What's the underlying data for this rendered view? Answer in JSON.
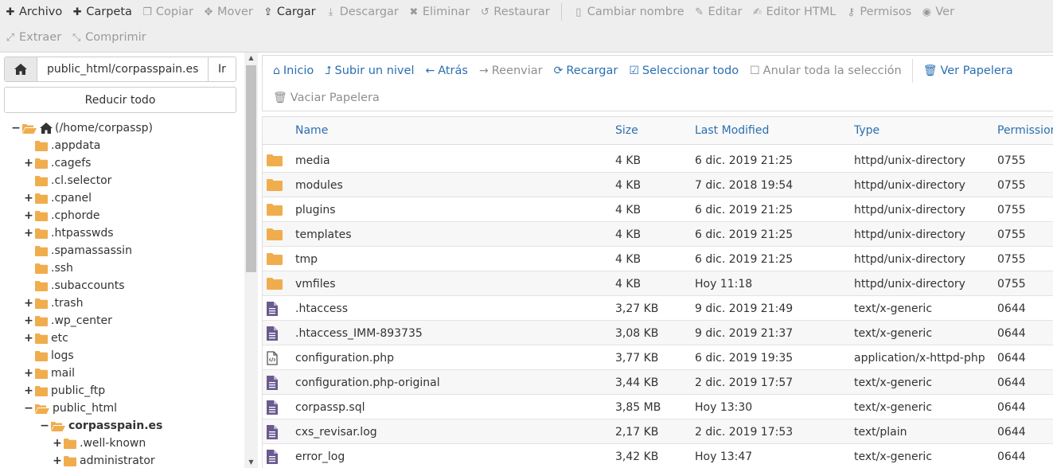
{
  "toolbar": {
    "row1": [
      {
        "label": "Archivo",
        "icon": "plus-icon",
        "glyph": "✚",
        "disabled": false
      },
      {
        "label": "Carpeta",
        "icon": "plus-icon",
        "glyph": "✚",
        "disabled": false
      },
      {
        "label": "Copiar",
        "icon": "copy-icon",
        "glyph": "❐",
        "disabled": true
      },
      {
        "label": "Mover",
        "icon": "move-icon",
        "glyph": "✥",
        "disabled": true
      },
      {
        "label": "Cargar",
        "icon": "upload-icon",
        "glyph": "⇪",
        "disabled": false
      },
      {
        "label": "Descargar",
        "icon": "download-icon",
        "glyph": "⤓",
        "disabled": true
      },
      {
        "label": "Eliminar",
        "icon": "delete-icon",
        "glyph": "✖",
        "disabled": true
      },
      {
        "label": "Restaurar",
        "icon": "restore-icon",
        "glyph": "↺",
        "disabled": true
      },
      {
        "label": "Cambiar nombre",
        "icon": "file-icon",
        "glyph": "▯",
        "disabled": true
      },
      {
        "label": "Editar",
        "icon": "pencil-icon",
        "glyph": "✎",
        "disabled": true
      },
      {
        "label": "Editor HTML",
        "icon": "edit-icon",
        "glyph": "✍",
        "disabled": true
      },
      {
        "label": "Permisos",
        "icon": "key-icon",
        "glyph": "⚷",
        "disabled": true
      },
      {
        "label": "Ver",
        "icon": "eye-icon",
        "glyph": "◉",
        "disabled": true
      }
    ],
    "row2": [
      {
        "label": "Extraer",
        "icon": "expand-icon",
        "glyph": "⤢",
        "disabled": true
      },
      {
        "label": "Comprimir",
        "icon": "compress-icon",
        "glyph": "⤡",
        "disabled": true
      }
    ]
  },
  "left": {
    "path_value": "public_html/corpasspain.es",
    "go_label": "Ir",
    "collapse_label": "Reducir todo",
    "tree": [
      {
        "label": "(/home/corpassp)",
        "toggle": "−",
        "depth": 0,
        "open": true,
        "home": true,
        "bold": false
      },
      {
        "label": ".appdata",
        "toggle": "",
        "depth": 1,
        "open": false,
        "home": false,
        "bold": false
      },
      {
        "label": ".cagefs",
        "toggle": "+",
        "depth": 1,
        "open": false,
        "home": false,
        "bold": false
      },
      {
        "label": ".cl.selector",
        "toggle": "",
        "depth": 1,
        "open": false,
        "home": false,
        "bold": false
      },
      {
        "label": ".cpanel",
        "toggle": "+",
        "depth": 1,
        "open": false,
        "home": false,
        "bold": false
      },
      {
        "label": ".cphorde",
        "toggle": "+",
        "depth": 1,
        "open": false,
        "home": false,
        "bold": false
      },
      {
        "label": ".htpasswds",
        "toggle": "+",
        "depth": 1,
        "open": false,
        "home": false,
        "bold": false
      },
      {
        "label": ".spamassassin",
        "toggle": "",
        "depth": 1,
        "open": false,
        "home": false,
        "bold": false
      },
      {
        "label": ".ssh",
        "toggle": "",
        "depth": 1,
        "open": false,
        "home": false,
        "bold": false
      },
      {
        "label": ".subaccounts",
        "toggle": "",
        "depth": 1,
        "open": false,
        "home": false,
        "bold": false
      },
      {
        "label": ".trash",
        "toggle": "+",
        "depth": 1,
        "open": false,
        "home": false,
        "bold": false
      },
      {
        "label": ".wp_center",
        "toggle": "+",
        "depth": 1,
        "open": false,
        "home": false,
        "bold": false
      },
      {
        "label": "etc",
        "toggle": "+",
        "depth": 1,
        "open": false,
        "home": false,
        "bold": false
      },
      {
        "label": "logs",
        "toggle": "",
        "depth": 1,
        "open": false,
        "home": false,
        "bold": false
      },
      {
        "label": "mail",
        "toggle": "+",
        "depth": 1,
        "open": false,
        "home": false,
        "bold": false
      },
      {
        "label": "public_ftp",
        "toggle": "+",
        "depth": 1,
        "open": false,
        "home": false,
        "bold": false
      },
      {
        "label": "public_html",
        "toggle": "−",
        "depth": 1,
        "open": true,
        "home": false,
        "bold": false
      },
      {
        "label": "corpasspain.es",
        "toggle": "−",
        "depth": 2,
        "open": true,
        "home": false,
        "bold": true
      },
      {
        "label": ".well-known",
        "toggle": "+",
        "depth": 3,
        "open": false,
        "home": false,
        "bold": false
      },
      {
        "label": "administrator",
        "toggle": "+",
        "depth": 3,
        "open": false,
        "home": false,
        "bold": false
      }
    ]
  },
  "nav": {
    "row1": [
      {
        "label": "Inicio",
        "icon": "home-icon",
        "glyph": "⌂",
        "disabled": false
      },
      {
        "label": "Subir un nivel",
        "icon": "level-up-icon",
        "glyph": "⮥",
        "disabled": false
      },
      {
        "label": "Atrás",
        "icon": "arrow-left-icon",
        "glyph": "←",
        "disabled": false
      },
      {
        "label": "Reenviar",
        "icon": "arrow-right-icon",
        "glyph": "→",
        "disabled": true
      },
      {
        "label": "Recargar",
        "icon": "refresh-icon",
        "glyph": "⟳",
        "disabled": false
      },
      {
        "label": "Seleccionar todo",
        "icon": "check-square-icon",
        "glyph": "☑",
        "disabled": false
      },
      {
        "label": "Anular toda la selección",
        "icon": "square-icon",
        "glyph": "☐",
        "disabled": true
      },
      {
        "label": "Ver Papelera",
        "icon": "trash-icon",
        "glyph": "🗑",
        "disabled": false
      }
    ],
    "row2": [
      {
        "label": "Vaciar Papelera",
        "icon": "trash-icon",
        "glyph": "🗑",
        "disabled": true
      }
    ]
  },
  "table": {
    "columns": [
      "Name",
      "Size",
      "Last Modified",
      "Type",
      "Permissions"
    ],
    "rows": [
      {
        "icon": "folder-icon",
        "name": "media",
        "size": "4 KB",
        "modified": "6 dic. 2019 21:25",
        "type": "httpd/unix-directory",
        "perms": "0755"
      },
      {
        "icon": "folder-icon",
        "name": "modules",
        "size": "4 KB",
        "modified": "7 dic. 2018 19:54",
        "type": "httpd/unix-directory",
        "perms": "0755"
      },
      {
        "icon": "folder-icon",
        "name": "plugins",
        "size": "4 KB",
        "modified": "6 dic. 2019 21:25",
        "type": "httpd/unix-directory",
        "perms": "0755"
      },
      {
        "icon": "folder-icon",
        "name": "templates",
        "size": "4 KB",
        "modified": "6 dic. 2019 21:25",
        "type": "httpd/unix-directory",
        "perms": "0755"
      },
      {
        "icon": "folder-icon",
        "name": "tmp",
        "size": "4 KB",
        "modified": "6 dic. 2019 21:25",
        "type": "httpd/unix-directory",
        "perms": "0755"
      },
      {
        "icon": "folder-icon",
        "name": "vmfiles",
        "size": "4 KB",
        "modified": "Hoy 11:18",
        "type": "httpd/unix-directory",
        "perms": "0755"
      },
      {
        "icon": "file-text-icon",
        "name": ".htaccess",
        "size": "3,27 KB",
        "modified": "9 dic. 2019 21:49",
        "type": "text/x-generic",
        "perms": "0644"
      },
      {
        "icon": "file-text-icon",
        "name": ".htaccess_IMM-893735",
        "size": "3,08 KB",
        "modified": "9 dic. 2019 21:37",
        "type": "text/x-generic",
        "perms": "0644"
      },
      {
        "icon": "file-code-icon",
        "name": "configuration.php",
        "size": "3,77 KB",
        "modified": "6 dic. 2019 19:35",
        "type": "application/x-httpd-php",
        "perms": "0644"
      },
      {
        "icon": "file-text-icon",
        "name": "configuration.php-original",
        "size": "3,44 KB",
        "modified": "2 dic. 2019 17:57",
        "type": "text/x-generic",
        "perms": "0644"
      },
      {
        "icon": "file-text-icon",
        "name": "corpassp.sql",
        "size": "3,85 MB",
        "modified": "Hoy 13:30",
        "type": "text/x-generic",
        "perms": "0644"
      },
      {
        "icon": "file-text-icon",
        "name": "cxs_revisar.log",
        "size": "2,17 KB",
        "modified": "2 dic. 2019 17:53",
        "type": "text/plain",
        "perms": "0644"
      },
      {
        "icon": "file-text-icon",
        "name": "error_log",
        "size": "3,42 KB",
        "modified": "Hoy 13:47",
        "type": "text/x-generic",
        "perms": "0644"
      }
    ]
  },
  "colors": {
    "folder": "#f0ad4e",
    "file": "#6a5a8f",
    "link": "#2a6fb1",
    "disabled": "#9a9a9a"
  }
}
